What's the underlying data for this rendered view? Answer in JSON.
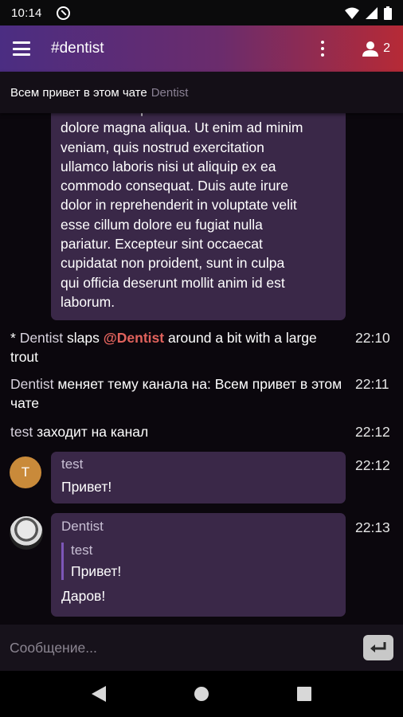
{
  "status": {
    "time": "10:14"
  },
  "appbar": {
    "channel": "#dentist",
    "users_count": "2"
  },
  "topic": {
    "text": "Всем привет в этом чате",
    "author": "Dentist"
  },
  "messages": {
    "long_text": "eiusmod tempor incididunt ut labore et\ndolore magna aliqua. Ut enim ad minim\nveniam, quis nostrud exercitation\nullamco laboris nisi ut aliquip ex ea\ncommodo consequat. Duis aute irure\ndolor in reprehenderit in voluptate velit\nesse cillum dolore eu fugiat nulla\npariatur. Excepteur sint occaecat\ncupidatat non proident, sunt in culpa\nqui officia deserunt mollit anim id est\nlaborum.",
    "action": {
      "prefix": "* ",
      "nick": "Dentist",
      "verb": " slaps ",
      "mention": "@Dentist",
      "rest": " around a bit with a large trout",
      "time": "22:10"
    },
    "topic_change": {
      "nick": "Dentist",
      "text": " меняет тему канала на: Всем привет в этом чате",
      "time": "22:11"
    },
    "join": {
      "nick": "test",
      "text": " заходит на канал",
      "time": "22:12"
    },
    "msg1": {
      "avatar_letter": "T",
      "author": "test",
      "body": "Привет!",
      "time": "22:12"
    },
    "msg2": {
      "author": "Dentist",
      "quote_author": "test",
      "quote_text": "Привет!",
      "body": "Даров!",
      "time": "22:13"
    }
  },
  "composer": {
    "placeholder": "Сообщение..."
  }
}
